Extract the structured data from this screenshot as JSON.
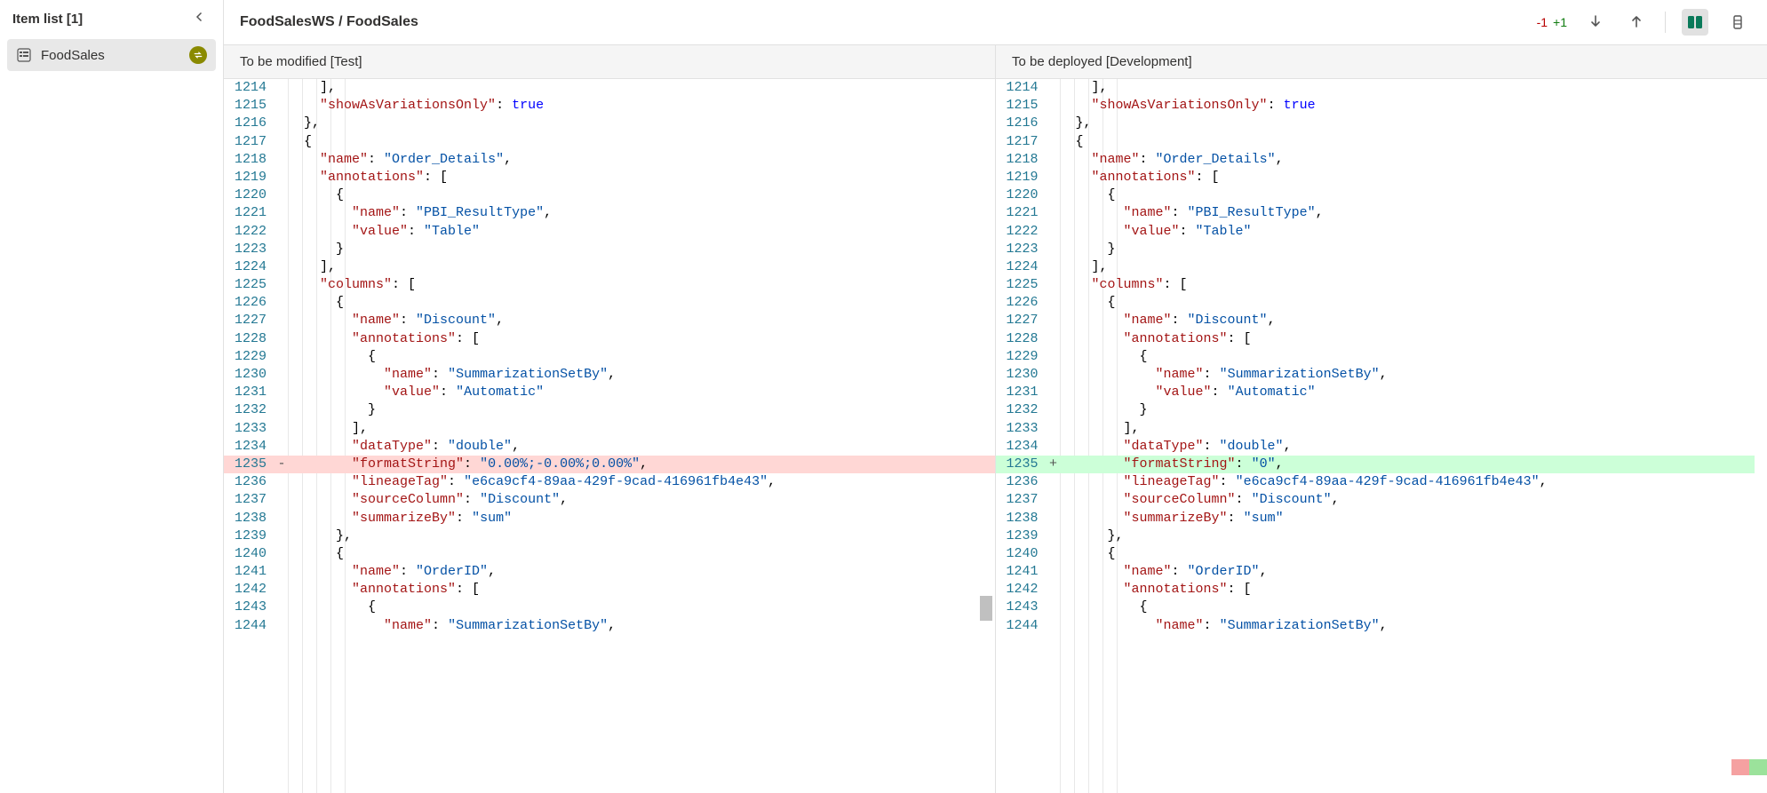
{
  "sidebar": {
    "title": "Item list [1]",
    "item_label": "FoodSales"
  },
  "header": {
    "breadcrumb": "FoodSalesWS / FoodSales",
    "stat_minus": "-1",
    "stat_plus": "+1"
  },
  "pane_titles": {
    "left": "To be modified [Test]",
    "right": "To be deployed [Development]"
  },
  "diff_line": 1235,
  "lines_start": 1214,
  "lines_end": 1244,
  "code_left": [
    {
      "n": 1214,
      "indent": 2,
      "tokens": [
        {
          "t": "],",
          "c": "k-punc"
        }
      ]
    },
    {
      "n": 1215,
      "indent": 2,
      "tokens": [
        {
          "t": "\"showAsVariationsOnly\"",
          "c": "k-key"
        },
        {
          "t": ": ",
          "c": "k-punc"
        },
        {
          "t": "true",
          "c": "k-bool"
        }
      ]
    },
    {
      "n": 1216,
      "indent": 1,
      "tokens": [
        {
          "t": "},",
          "c": "k-punc"
        }
      ]
    },
    {
      "n": 1217,
      "indent": 1,
      "tokens": [
        {
          "t": "{",
          "c": "k-punc"
        }
      ]
    },
    {
      "n": 1218,
      "indent": 2,
      "tokens": [
        {
          "t": "\"name\"",
          "c": "k-key"
        },
        {
          "t": ": ",
          "c": "k-punc"
        },
        {
          "t": "\"Order_Details\"",
          "c": "k-str"
        },
        {
          "t": ",",
          "c": "k-punc"
        }
      ]
    },
    {
      "n": 1219,
      "indent": 2,
      "tokens": [
        {
          "t": "\"annotations\"",
          "c": "k-key"
        },
        {
          "t": ": [",
          "c": "k-punc"
        }
      ]
    },
    {
      "n": 1220,
      "indent": 3,
      "tokens": [
        {
          "t": "{",
          "c": "k-punc"
        }
      ]
    },
    {
      "n": 1221,
      "indent": 4,
      "tokens": [
        {
          "t": "\"name\"",
          "c": "k-key"
        },
        {
          "t": ": ",
          "c": "k-punc"
        },
        {
          "t": "\"PBI_ResultType\"",
          "c": "k-str"
        },
        {
          "t": ",",
          "c": "k-punc"
        }
      ]
    },
    {
      "n": 1222,
      "indent": 4,
      "tokens": [
        {
          "t": "\"value\"",
          "c": "k-key"
        },
        {
          "t": ": ",
          "c": "k-punc"
        },
        {
          "t": "\"Table\"",
          "c": "k-str"
        }
      ]
    },
    {
      "n": 1223,
      "indent": 3,
      "tokens": [
        {
          "t": "}",
          "c": "k-punc"
        }
      ]
    },
    {
      "n": 1224,
      "indent": 2,
      "tokens": [
        {
          "t": "],",
          "c": "k-punc"
        }
      ]
    },
    {
      "n": 1225,
      "indent": 2,
      "tokens": [
        {
          "t": "\"columns\"",
          "c": "k-key"
        },
        {
          "t": ": [",
          "c": "k-punc"
        }
      ]
    },
    {
      "n": 1226,
      "indent": 3,
      "tokens": [
        {
          "t": "{",
          "c": "k-punc"
        }
      ]
    },
    {
      "n": 1227,
      "indent": 4,
      "tokens": [
        {
          "t": "\"name\"",
          "c": "k-key"
        },
        {
          "t": ": ",
          "c": "k-punc"
        },
        {
          "t": "\"Discount\"",
          "c": "k-str"
        },
        {
          "t": ",",
          "c": "k-punc"
        }
      ]
    },
    {
      "n": 1228,
      "indent": 4,
      "tokens": [
        {
          "t": "\"annotations\"",
          "c": "k-key"
        },
        {
          "t": ": [",
          "c": "k-punc"
        }
      ]
    },
    {
      "n": 1229,
      "indent": 5,
      "tokens": [
        {
          "t": "{",
          "c": "k-punc"
        }
      ]
    },
    {
      "n": 1230,
      "indent": 6,
      "tokens": [
        {
          "t": "\"name\"",
          "c": "k-key"
        },
        {
          "t": ": ",
          "c": "k-punc"
        },
        {
          "t": "\"SummarizationSetBy\"",
          "c": "k-str"
        },
        {
          "t": ",",
          "c": "k-punc"
        }
      ]
    },
    {
      "n": 1231,
      "indent": 6,
      "tokens": [
        {
          "t": "\"value\"",
          "c": "k-key"
        },
        {
          "t": ": ",
          "c": "k-punc"
        },
        {
          "t": "\"Automatic\"",
          "c": "k-str"
        }
      ]
    },
    {
      "n": 1232,
      "indent": 5,
      "tokens": [
        {
          "t": "}",
          "c": "k-punc"
        }
      ]
    },
    {
      "n": 1233,
      "indent": 4,
      "tokens": [
        {
          "t": "],",
          "c": "k-punc"
        }
      ]
    },
    {
      "n": 1234,
      "indent": 4,
      "tokens": [
        {
          "t": "\"dataType\"",
          "c": "k-key"
        },
        {
          "t": ": ",
          "c": "k-punc"
        },
        {
          "t": "\"double\"",
          "c": "k-str"
        },
        {
          "t": ",",
          "c": "k-punc"
        }
      ]
    },
    {
      "n": 1235,
      "indent": 4,
      "diff": "del",
      "tokens": [
        {
          "t": "\"formatString\"",
          "c": "k-key"
        },
        {
          "t": ": ",
          "c": "k-punc"
        },
        {
          "t": "\"0.00%;-0.00%;0.00%\"",
          "c": "k-str"
        },
        {
          "t": ",",
          "c": "k-punc"
        }
      ]
    },
    {
      "n": 1236,
      "indent": 4,
      "tokens": [
        {
          "t": "\"lineageTag\"",
          "c": "k-key"
        },
        {
          "t": ": ",
          "c": "k-punc"
        },
        {
          "t": "\"e6ca9cf4-89aa-429f-9cad-416961fb4e43\"",
          "c": "k-str"
        },
        {
          "t": ",",
          "c": "k-punc"
        }
      ]
    },
    {
      "n": 1237,
      "indent": 4,
      "tokens": [
        {
          "t": "\"sourceColumn\"",
          "c": "k-key"
        },
        {
          "t": ": ",
          "c": "k-punc"
        },
        {
          "t": "\"Discount\"",
          "c": "k-str"
        },
        {
          "t": ",",
          "c": "k-punc"
        }
      ]
    },
    {
      "n": 1238,
      "indent": 4,
      "tokens": [
        {
          "t": "\"summarizeBy\"",
          "c": "k-key"
        },
        {
          "t": ": ",
          "c": "k-punc"
        },
        {
          "t": "\"sum\"",
          "c": "k-str"
        }
      ]
    },
    {
      "n": 1239,
      "indent": 3,
      "tokens": [
        {
          "t": "},",
          "c": "k-punc"
        }
      ]
    },
    {
      "n": 1240,
      "indent": 3,
      "tokens": [
        {
          "t": "{",
          "c": "k-punc"
        }
      ]
    },
    {
      "n": 1241,
      "indent": 4,
      "tokens": [
        {
          "t": "\"name\"",
          "c": "k-key"
        },
        {
          "t": ": ",
          "c": "k-punc"
        },
        {
          "t": "\"OrderID\"",
          "c": "k-str"
        },
        {
          "t": ",",
          "c": "k-punc"
        }
      ]
    },
    {
      "n": 1242,
      "indent": 4,
      "tokens": [
        {
          "t": "\"annotations\"",
          "c": "k-key"
        },
        {
          "t": ": [",
          "c": "k-punc"
        }
      ]
    },
    {
      "n": 1243,
      "indent": 5,
      "tokens": [
        {
          "t": "{",
          "c": "k-punc"
        }
      ]
    },
    {
      "n": 1244,
      "indent": 6,
      "tokens": [
        {
          "t": "\"name\"",
          "c": "k-key"
        },
        {
          "t": ": ",
          "c": "k-punc"
        },
        {
          "t": "\"SummarizationSetBy\"",
          "c": "k-str"
        },
        {
          "t": ",",
          "c": "k-punc"
        }
      ]
    }
  ],
  "code_right": [
    {
      "n": 1214,
      "indent": 2,
      "tokens": [
        {
          "t": "],",
          "c": "k-punc"
        }
      ]
    },
    {
      "n": 1215,
      "indent": 2,
      "tokens": [
        {
          "t": "\"showAsVariationsOnly\"",
          "c": "k-key"
        },
        {
          "t": ": ",
          "c": "k-punc"
        },
        {
          "t": "true",
          "c": "k-bool"
        }
      ]
    },
    {
      "n": 1216,
      "indent": 1,
      "tokens": [
        {
          "t": "},",
          "c": "k-punc"
        }
      ]
    },
    {
      "n": 1217,
      "indent": 1,
      "tokens": [
        {
          "t": "{",
          "c": "k-punc"
        }
      ]
    },
    {
      "n": 1218,
      "indent": 2,
      "tokens": [
        {
          "t": "\"name\"",
          "c": "k-key"
        },
        {
          "t": ": ",
          "c": "k-punc"
        },
        {
          "t": "\"Order_Details\"",
          "c": "k-str"
        },
        {
          "t": ",",
          "c": "k-punc"
        }
      ]
    },
    {
      "n": 1219,
      "indent": 2,
      "tokens": [
        {
          "t": "\"annotations\"",
          "c": "k-key"
        },
        {
          "t": ": [",
          "c": "k-punc"
        }
      ]
    },
    {
      "n": 1220,
      "indent": 3,
      "tokens": [
        {
          "t": "{",
          "c": "k-punc"
        }
      ]
    },
    {
      "n": 1221,
      "indent": 4,
      "tokens": [
        {
          "t": "\"name\"",
          "c": "k-key"
        },
        {
          "t": ": ",
          "c": "k-punc"
        },
        {
          "t": "\"PBI_ResultType\"",
          "c": "k-str"
        },
        {
          "t": ",",
          "c": "k-punc"
        }
      ]
    },
    {
      "n": 1222,
      "indent": 4,
      "tokens": [
        {
          "t": "\"value\"",
          "c": "k-key"
        },
        {
          "t": ": ",
          "c": "k-punc"
        },
        {
          "t": "\"Table\"",
          "c": "k-str"
        }
      ]
    },
    {
      "n": 1223,
      "indent": 3,
      "tokens": [
        {
          "t": "}",
          "c": "k-punc"
        }
      ]
    },
    {
      "n": 1224,
      "indent": 2,
      "tokens": [
        {
          "t": "],",
          "c": "k-punc"
        }
      ]
    },
    {
      "n": 1225,
      "indent": 2,
      "tokens": [
        {
          "t": "\"columns\"",
          "c": "k-key"
        },
        {
          "t": ": [",
          "c": "k-punc"
        }
      ]
    },
    {
      "n": 1226,
      "indent": 3,
      "tokens": [
        {
          "t": "{",
          "c": "k-punc"
        }
      ]
    },
    {
      "n": 1227,
      "indent": 4,
      "tokens": [
        {
          "t": "\"name\"",
          "c": "k-key"
        },
        {
          "t": ": ",
          "c": "k-punc"
        },
        {
          "t": "\"Discount\"",
          "c": "k-str"
        },
        {
          "t": ",",
          "c": "k-punc"
        }
      ]
    },
    {
      "n": 1228,
      "indent": 4,
      "tokens": [
        {
          "t": "\"annotations\"",
          "c": "k-key"
        },
        {
          "t": ": [",
          "c": "k-punc"
        }
      ]
    },
    {
      "n": 1229,
      "indent": 5,
      "tokens": [
        {
          "t": "{",
          "c": "k-punc"
        }
      ]
    },
    {
      "n": 1230,
      "indent": 6,
      "tokens": [
        {
          "t": "\"name\"",
          "c": "k-key"
        },
        {
          "t": ": ",
          "c": "k-punc"
        },
        {
          "t": "\"SummarizationSetBy\"",
          "c": "k-str"
        },
        {
          "t": ",",
          "c": "k-punc"
        }
      ]
    },
    {
      "n": 1231,
      "indent": 6,
      "tokens": [
        {
          "t": "\"value\"",
          "c": "k-key"
        },
        {
          "t": ": ",
          "c": "k-punc"
        },
        {
          "t": "\"Automatic\"",
          "c": "k-str"
        }
      ]
    },
    {
      "n": 1232,
      "indent": 5,
      "tokens": [
        {
          "t": "}",
          "c": "k-punc"
        }
      ]
    },
    {
      "n": 1233,
      "indent": 4,
      "tokens": [
        {
          "t": "],",
          "c": "k-punc"
        }
      ]
    },
    {
      "n": 1234,
      "indent": 4,
      "tokens": [
        {
          "t": "\"dataType\"",
          "c": "k-key"
        },
        {
          "t": ": ",
          "c": "k-punc"
        },
        {
          "t": "\"double\"",
          "c": "k-str"
        },
        {
          "t": ",",
          "c": "k-punc"
        }
      ]
    },
    {
      "n": 1235,
      "indent": 4,
      "diff": "add",
      "tokens": [
        {
          "t": "\"formatString\"",
          "c": "k-key"
        },
        {
          "t": ": ",
          "c": "k-punc"
        },
        {
          "t": "\"0\"",
          "c": "k-str"
        },
        {
          "t": ",",
          "c": "k-punc"
        }
      ]
    },
    {
      "n": 1236,
      "indent": 4,
      "tokens": [
        {
          "t": "\"lineageTag\"",
          "c": "k-key"
        },
        {
          "t": ": ",
          "c": "k-punc"
        },
        {
          "t": "\"e6ca9cf4-89aa-429f-9cad-416961fb4e43\"",
          "c": "k-str"
        },
        {
          "t": ",",
          "c": "k-punc"
        }
      ]
    },
    {
      "n": 1237,
      "indent": 4,
      "tokens": [
        {
          "t": "\"sourceColumn\"",
          "c": "k-key"
        },
        {
          "t": ": ",
          "c": "k-punc"
        },
        {
          "t": "\"Discount\"",
          "c": "k-str"
        },
        {
          "t": ",",
          "c": "k-punc"
        }
      ]
    },
    {
      "n": 1238,
      "indent": 4,
      "tokens": [
        {
          "t": "\"summarizeBy\"",
          "c": "k-key"
        },
        {
          "t": ": ",
          "c": "k-punc"
        },
        {
          "t": "\"sum\"",
          "c": "k-str"
        }
      ]
    },
    {
      "n": 1239,
      "indent": 3,
      "tokens": [
        {
          "t": "},",
          "c": "k-punc"
        }
      ]
    },
    {
      "n": 1240,
      "indent": 3,
      "tokens": [
        {
          "t": "{",
          "c": "k-punc"
        }
      ]
    },
    {
      "n": 1241,
      "indent": 4,
      "tokens": [
        {
          "t": "\"name\"",
          "c": "k-key"
        },
        {
          "t": ": ",
          "c": "k-punc"
        },
        {
          "t": "\"OrderID\"",
          "c": "k-str"
        },
        {
          "t": ",",
          "c": "k-punc"
        }
      ]
    },
    {
      "n": 1242,
      "indent": 4,
      "tokens": [
        {
          "t": "\"annotations\"",
          "c": "k-key"
        },
        {
          "t": ": [",
          "c": "k-punc"
        }
      ]
    },
    {
      "n": 1243,
      "indent": 5,
      "tokens": [
        {
          "t": "{",
          "c": "k-punc"
        }
      ]
    },
    {
      "n": 1244,
      "indent": 6,
      "tokens": [
        {
          "t": "\"name\"",
          "c": "k-key"
        },
        {
          "t": ": ",
          "c": "k-punc"
        },
        {
          "t": "\"SummarizationSetBy\"",
          "c": "k-str"
        },
        {
          "t": ",",
          "c": "k-punc"
        }
      ]
    }
  ]
}
